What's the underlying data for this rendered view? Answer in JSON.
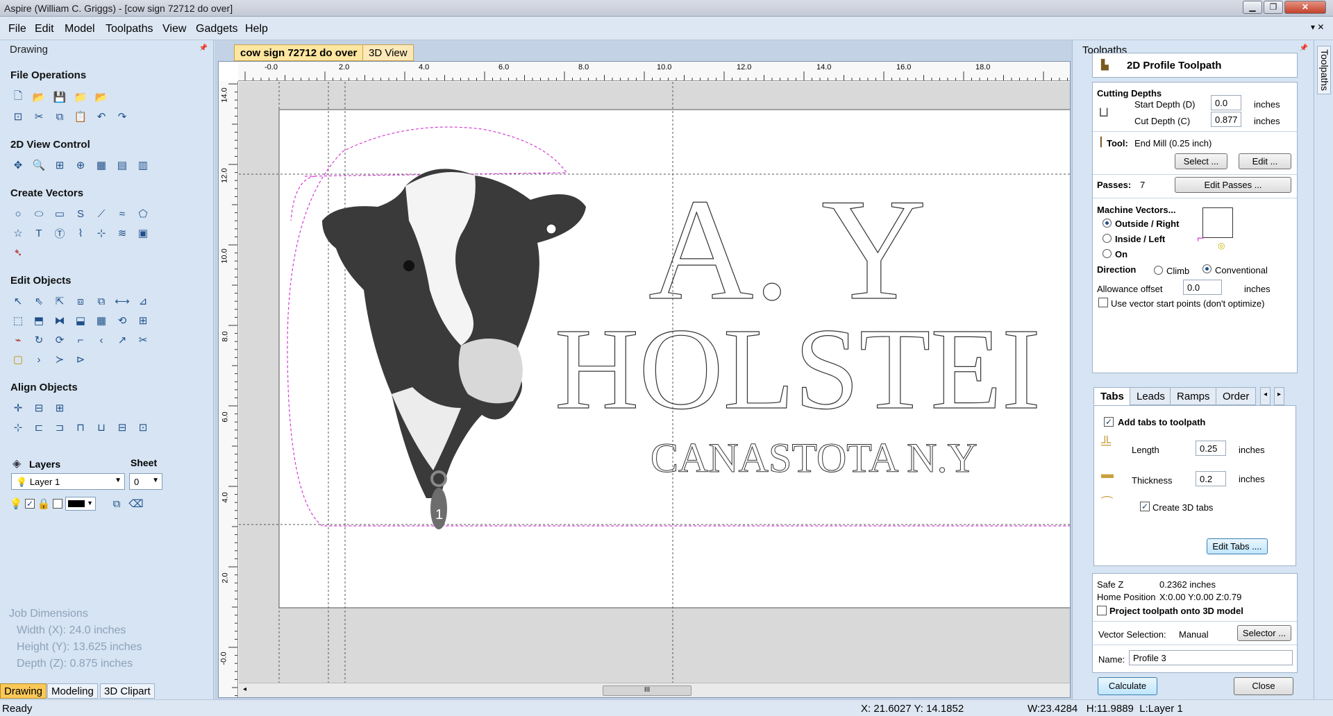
{
  "window": {
    "title": "Aspire (William C. Griggs) - [cow sign 72712 do over]"
  },
  "menu": [
    "File",
    "Edit",
    "Model",
    "Toolpaths",
    "View",
    "Gadgets",
    "Help"
  ],
  "left_panel": {
    "title": "Drawing",
    "sections": {
      "file_ops": "File Operations",
      "view_control": "2D View Control",
      "create_vectors": "Create Vectors",
      "edit_objects": "Edit Objects",
      "align_objects": "Align Objects"
    },
    "layers": {
      "label": "Layers",
      "sheet_label": "Sheet",
      "layer_value": "Layer 1",
      "sheet_value": "0"
    },
    "job_dimensions": {
      "title": "Job Dimensions",
      "width": "Width  (X): 24.0 inches",
      "height": "Height (Y): 13.625 inches",
      "depth": "Depth  (Z): 0.875 inches"
    },
    "tabs": [
      "Drawing",
      "Modeling",
      "3D Clipart"
    ]
  },
  "document": {
    "tabs": [
      "cow sign 72712 do over",
      "3D View"
    ],
    "h_ruler": [
      "-0.0",
      "2.0",
      "4.0",
      "6.0",
      "8.0",
      "10.0",
      "12.0",
      "14.0",
      "16.0",
      "18.0"
    ],
    "v_ruler": [
      "14.0",
      "12.0",
      "10.0",
      "8.0",
      "6.0",
      "4.0",
      "2.0",
      "-0.0"
    ],
    "sign_text": {
      "line1": "A. Y",
      "line2": "HOLSTEI",
      "line3": "CANASTOTA N.Y",
      "tag": "1"
    },
    "scroll_grip": "III"
  },
  "toolpath_panel": {
    "title": "Toolpaths",
    "header": "2D Profile Toolpath",
    "cutting_depths": {
      "title": "Cutting Depths",
      "start_label": "Start Depth (D)",
      "start_value": "0.0",
      "cut_label": "Cut Depth (C)",
      "cut_value": "0.877",
      "unit": "inches"
    },
    "tool": {
      "label": "Tool:",
      "value": "End Mill (0.25 inch)",
      "select_btn": "Select ...",
      "edit_btn": "Edit ..."
    },
    "passes": {
      "label": "Passes:",
      "value": "7",
      "btn": "Edit Passes ..."
    },
    "machine_vectors": {
      "title": "Machine Vectors...",
      "options": [
        "Outside / Right",
        "Inside / Left",
        "On"
      ],
      "direction_label": "Direction",
      "climb": "Climb",
      "conventional": "Conventional",
      "allowance_label": "Allowance offset",
      "allowance_value": "0.0",
      "unit": "inches",
      "start_points": "Use vector start points (don't optimize)"
    },
    "tabs": [
      "Tabs",
      "Leads",
      "Ramps",
      "Order"
    ],
    "tabs_panel": {
      "add_tabs": "Add tabs to toolpath",
      "length_label": "Length",
      "length_value": "0.25",
      "thickness_label": "Thickness",
      "thickness_value": "0.2",
      "unit": "inches",
      "create_3d": "Create 3D tabs",
      "edit_btn": "Edit Tabs ...."
    },
    "footer": {
      "safe_z_label": "Safe Z",
      "safe_z_value": "0.2362 inches",
      "home_label": "Home Position",
      "home_value": "X:0.00 Y:0.00 Z:0.79",
      "project": "Project toolpath onto 3D model",
      "vector_sel_label": "Vector Selection:",
      "vector_sel_value": "Manual",
      "selector_btn": "Selector ...",
      "name_label": "Name:",
      "name_value": "Profile 3",
      "calculate": "Calculate",
      "close": "Close"
    },
    "side_tab": "Toolpaths"
  },
  "status": {
    "ready": "Ready",
    "coords": "X: 21.6027 Y: 14.1852",
    "size": "W:23.4284   H:11.9889  L:Layer 1"
  },
  "colors": {
    "accent": "#3c7fb1",
    "dashed_boundary": "#d43bd4",
    "doc_tab_active": "#fde6a0"
  }
}
